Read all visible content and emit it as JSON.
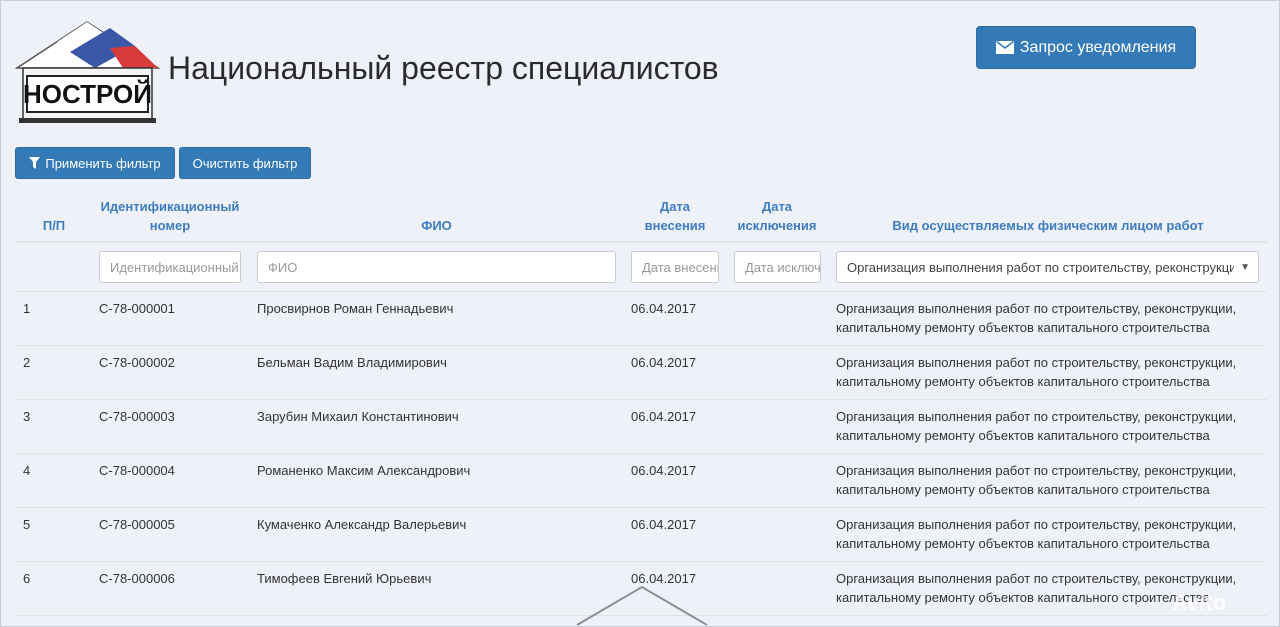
{
  "header": {
    "logo_text": "НОСТРОЙ",
    "title": "Национальный реестр специалистов",
    "notify_button": "Запрос уведомления"
  },
  "toolbar": {
    "apply_filter": "Применить фильтр",
    "clear_filter": "Очистить фильтр"
  },
  "table": {
    "columns": {
      "num": "П/П",
      "id_line1": "Идентификационный",
      "id_line2": "номер",
      "fio": "ФИО",
      "date_in_line1": "Дата",
      "date_in_line2": "внесения",
      "date_out_line1": "Дата",
      "date_out_line2": "исключения",
      "work": "Вид осуществляемых физическим лицом работ"
    },
    "filters": {
      "id_placeholder": "Идентификационный",
      "fio_placeholder": "ФИО",
      "date_in_placeholder": "Дата внесения",
      "date_out_placeholder": "Дата исключения",
      "work_selected": "Организация выполнения работ по строительству, реконструкции"
    },
    "rows": [
      {
        "num": "1",
        "id": "С-78-000001",
        "fio": "Просвирнов Роман Геннадьевич",
        "date_in": "06.04.2017",
        "work_line1": "Организация выполнения работ по строительству, реконструкции,",
        "work_line2": "капитальному ремонту объектов капитального строительства"
      },
      {
        "num": "2",
        "id": "С-78-000002",
        "fio": "Бельман Вадим Владимирович",
        "date_in": "06.04.2017",
        "work_line1": "Организация выполнения работ по строительству, реконструкции,",
        "work_line2": "капитальному ремонту объектов капитального строительства"
      },
      {
        "num": "3",
        "id": "С-78-000003",
        "fio": "Зарубин Михаил Константинович",
        "date_in": "06.04.2017",
        "work_line1": "Организация выполнения работ по строительству, реконструкции,",
        "work_line2": "капитальному ремонту объектов капитального строительства"
      },
      {
        "num": "4",
        "id": "С-78-000004",
        "fio": "Романенко Максим Александрович",
        "date_in": "06.04.2017",
        "work_line1": "Организация выполнения работ по строительству, реконструкции,",
        "work_line2": "капитальному ремонту объектов капитального строительства"
      },
      {
        "num": "5",
        "id": "С-78-000005",
        "fio": "Кумаченко Александр Валерьевич",
        "date_in": "06.04.2017",
        "work_line1": "Организация выполнения работ по строительству, реконструкции,",
        "work_line2": "капитальному ремонту объектов капитального строительства"
      },
      {
        "num": "6",
        "id": "С-78-000006",
        "fio": "Тимофеев Евгений Юрьевич",
        "date_in": "06.04.2017",
        "work_line1": "Организация выполнения работ по строительству, реконструкции,",
        "work_line2": "капитальному ремонту объектов капитального строительства"
      }
    ]
  },
  "watermark": "Avito",
  "colors": {
    "accent": "#337ab7",
    "header_text": "#3d7cbf"
  }
}
